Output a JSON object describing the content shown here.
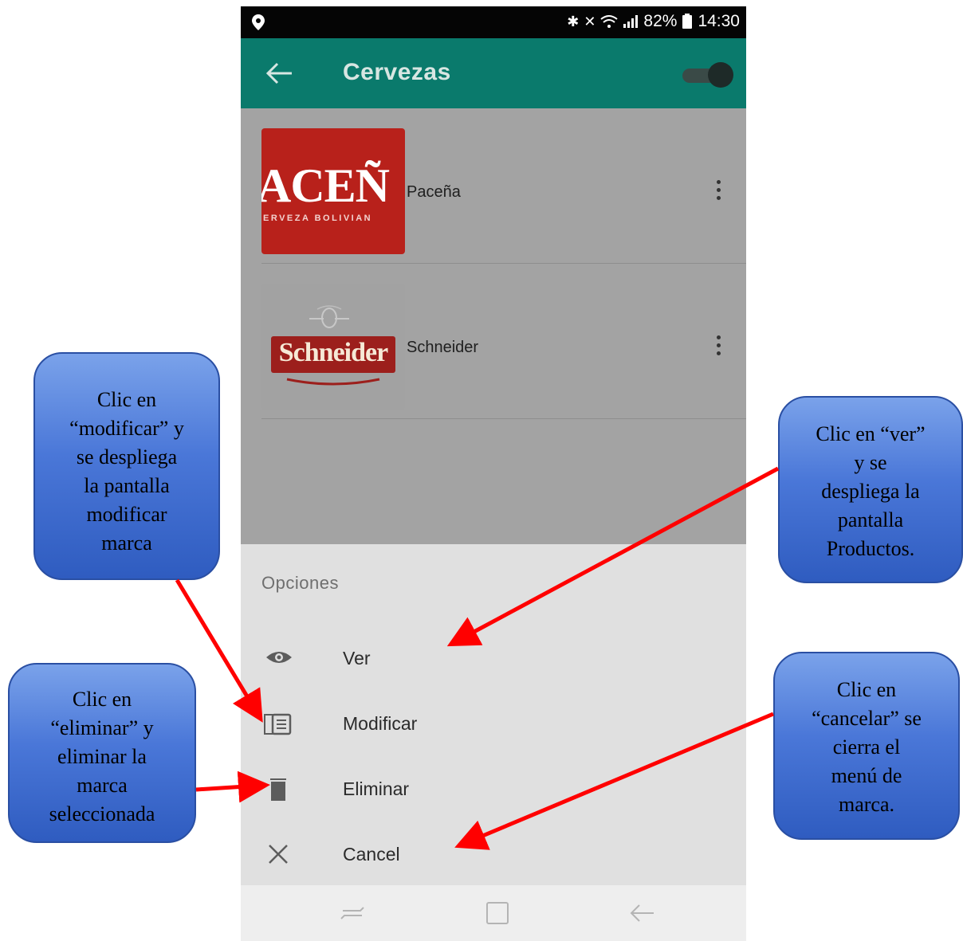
{
  "status_bar": {
    "battery": "82%",
    "time": "14:30"
  },
  "app_bar": {
    "title": "Cervezas"
  },
  "brands": [
    {
      "name": "Paceña",
      "logo_text": "ACEÑ",
      "logo_subtext": "ERVEZA BOLIVIAN"
    },
    {
      "name": "Schneider",
      "logo_text": "Schneider"
    }
  ],
  "sheet": {
    "title": "Opciones",
    "options": [
      {
        "label": "Ver",
        "icon": "eye-icon"
      },
      {
        "label": "Modificar",
        "icon": "edit-document-icon"
      },
      {
        "label": "Eliminar",
        "icon": "trash-icon"
      },
      {
        "label": "Cancel",
        "icon": "close-icon"
      }
    ]
  },
  "callouts": {
    "modificar": "Clic en\n“modificar” y\nse despliega\nla pantalla\nmodificar\nmarca",
    "eliminar": "Clic en\n“eliminar” y\neliminar la\nmarca\nseleccionada",
    "ver": "Clic en “ver”\ny se\ndespliega la\npantalla\nProductos.",
    "cancelar": "Clic en\n“cancelar” se\ncierra el\nmenú de\nmarca."
  },
  "colors": {
    "app_bar": "#0a7a6c",
    "arrow": "#ff0000",
    "callout": "#3f6fd2"
  }
}
